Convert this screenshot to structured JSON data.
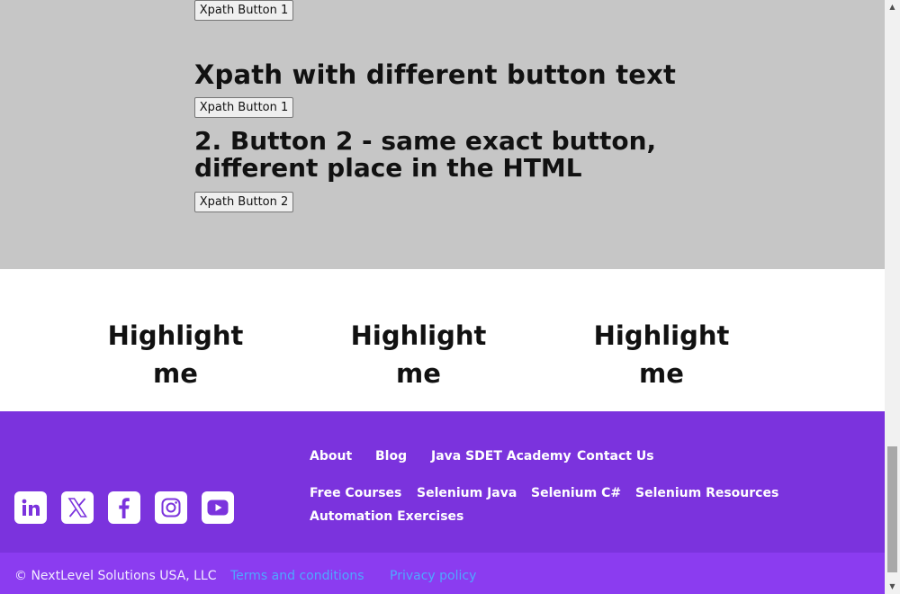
{
  "xpath_section": {
    "button_1_top_label": "Xpath Button 1",
    "heading_different_text": "Xpath with different button text",
    "button_1_label": "Xpath Button 1",
    "heading_button_2": "2. Button 2 - same exact button, different place in the HTML",
    "button_2_label": "Xpath Button 2"
  },
  "highlight_section": {
    "items": [
      "Highlight me",
      "Highlight me",
      "Highlight me"
    ]
  },
  "footer": {
    "social_icons": [
      "linkedin-icon",
      "x-twitter-icon",
      "facebook-icon",
      "instagram-icon",
      "youtube-icon"
    ],
    "nav_row_1": [
      "About",
      "Blog",
      "Java SDET Academy",
      "Contact Us"
    ],
    "nav_row_2": [
      "Free Courses",
      "Selenium Java",
      "Selenium C#",
      "Selenium Resources"
    ],
    "nav_row_3": [
      "Automation Exercises"
    ],
    "copyright": "© NextLevel Solutions USA, LLC",
    "terms_label": "Terms and conditions",
    "privacy_label": "Privacy policy"
  },
  "colors": {
    "gray_section_bg": "#c6c6c6",
    "footer_bg": "#7b33dd",
    "bottom_bar_bg": "#8b3cf0",
    "bottom_link": "#4ea8ff",
    "icon_color": "#7b33dd"
  }
}
